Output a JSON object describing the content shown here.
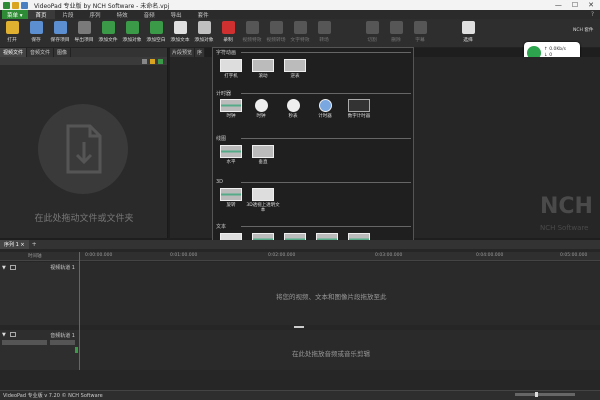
{
  "window": {
    "title": "VideoPad 专业版 by NCH Software - 未命名.vpj"
  },
  "menubar": {
    "menu_button": "菜单 ▾",
    "tabs": [
      "首页",
      "片段",
      "序列",
      "特效",
      "音频",
      "导出",
      "套件"
    ],
    "active_tab": 0,
    "help": "?"
  },
  "toolbar": {
    "items": [
      {
        "label": "打开",
        "icon": "folder-open-icon",
        "color": "#e0b030",
        "enabled": true
      },
      {
        "label": "保存",
        "icon": "save-icon",
        "color": "#5b8fd1",
        "enabled": true
      },
      {
        "label": "保存项目",
        "icon": "save-project-icon",
        "color": "#5b8fd1",
        "enabled": true
      },
      {
        "label": "导出项目",
        "icon": "export-project-icon",
        "color": "#7a7a7a",
        "enabled": true
      },
      {
        "label": "添加文件",
        "icon": "add-file-icon",
        "color": "#3a9a48",
        "enabled": true
      },
      {
        "label": "添加对象",
        "icon": "add-object-icon",
        "color": "#3a9a48",
        "enabled": true
      },
      {
        "label": "添加空白",
        "icon": "add-blank-icon",
        "color": "#3a9a48",
        "enabled": true
      },
      {
        "label": "添加文本",
        "icon": "add-text-icon",
        "color": "#e0e0e0",
        "enabled": true
      },
      {
        "label": "添加对象",
        "icon": "add-object-2-icon",
        "color": "#c0c0c0",
        "enabled": true
      },
      {
        "label": "录制",
        "icon": "record-icon",
        "color": "#d03030",
        "enabled": true
      },
      {
        "label": "视频特效",
        "icon": "video-effects-icon",
        "color": "#888",
        "enabled": false
      },
      {
        "label": "视频转场",
        "icon": "video-transition-icon",
        "color": "#888",
        "enabled": false
      },
      {
        "label": "文字特效",
        "icon": "text-effects-icon",
        "color": "#888",
        "enabled": false
      },
      {
        "label": "转场",
        "icon": "transition-icon",
        "color": "#888",
        "enabled": false
      },
      {
        "label": "",
        "icon": "spacer",
        "color": "#2e2e2e",
        "enabled": false
      },
      {
        "label": "切割",
        "icon": "split-icon",
        "color": "#888",
        "enabled": false
      },
      {
        "label": "删除",
        "icon": "delete-icon",
        "color": "#888",
        "enabled": false
      },
      {
        "label": "字幕",
        "icon": "subtitle-icon",
        "color": "#888",
        "enabled": false
      },
      {
        "label": "",
        "icon": "spacer",
        "color": "#2e2e2e",
        "enabled": false
      },
      {
        "label": "选择",
        "icon": "select-icon",
        "color": "#e0e0e0",
        "enabled": true
      }
    ],
    "nch_suite": "NCH 套件"
  },
  "cloud_badge": {
    "line1": "↑ 0.0Kb/s",
    "line2": "↓ 0"
  },
  "bin": {
    "tabs": [
      "视频文件",
      "音频文件",
      "图像"
    ],
    "active_tab": 0,
    "drop_text": "在此处拖动文件或文件夹"
  },
  "preview": {
    "tabs": [
      "片段预览",
      "序"
    ]
  },
  "watermark": {
    "logo": "NCH",
    "sub": "NCH Software"
  },
  "dropdown": {
    "sections": [
      {
        "title": "字符动画",
        "items": [
          "打字机",
          "滚动",
          "逆表"
        ]
      },
      {
        "title": "计时器",
        "items": [
          "时钟",
          "时钟",
          "秒表",
          "计时器",
          "数字计时器"
        ]
      },
      {
        "title": "线图",
        "items": [
          "水平",
          "垂直"
        ]
      },
      {
        "title": "3D",
        "items": [
          "旋转",
          "3D透视上透明文本"
        ]
      },
      {
        "title": "文本",
        "items": [
          "纯文本覆盖",
          "自下而上滚动",
          "自上而下滚动",
          "从左到右滚动",
          "从右到左滚动"
        ]
      }
    ]
  },
  "timeline": {
    "tab": "序列 1 ×",
    "add": "+",
    "ruler": [
      "时间轴",
      "0:00:00.000",
      "0:01:00.000",
      "0:02:00.000",
      "0:03:00.000",
      "0:04:00.000",
      "0:05:00.000"
    ],
    "video_track": {
      "name": "视频轨道 1",
      "hint": "将您的视频、文本和图像片段拖放至此"
    },
    "audio_track": {
      "name": "音频轨道 1",
      "hint": "在此处拖放音频或音乐剪辑"
    }
  },
  "status": {
    "text": "VideoPad 专业版 v 7.20 © NCH Software"
  }
}
